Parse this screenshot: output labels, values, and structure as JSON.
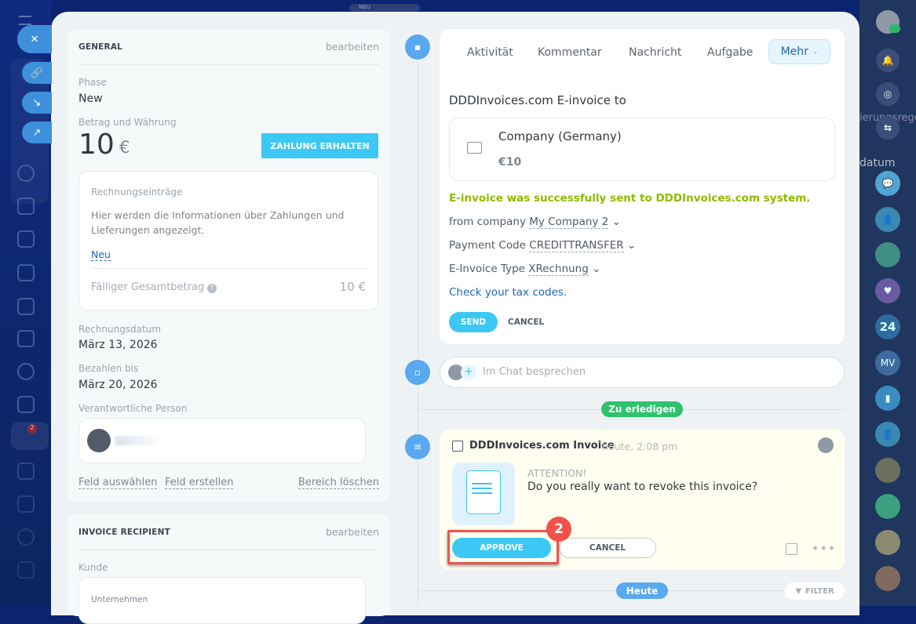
{
  "left_nav": {
    "badge": "2"
  },
  "top": {
    "new_label": "NEU",
    "badge": "2"
  },
  "right_nav": {
    "avatar_24": "24",
    "avatar_mv": "MV",
    "bg_text_1": "ierungsrege",
    "bg_text_2": "datum"
  },
  "general": {
    "title": "GENERAL",
    "edit": "bearbeiten",
    "phase_label": "Phase",
    "phase_value": "New",
    "amount_label": "Betrag und Währung",
    "amount": "10",
    "currency": "€",
    "pay_button": "ZAHLUNG ERHALTEN",
    "items_title": "Rechnungseinträge",
    "items_info": "Hier werden die Informationen über Zahlungen und Lieferungen angezeigt.",
    "items_new": "Neu",
    "total_label": "Fälliger Gesamtbetrag",
    "total_value": "10 €",
    "invoice_date_label": "Rechnungsdatum",
    "invoice_date": "März 13, 2026",
    "due_label": "Bezahlen bis",
    "due_date": "März 20, 2026",
    "responsible_label": "Verantwortliche Person",
    "select_field": "Feld auswählen",
    "create_field": "Feld erstellen",
    "delete_section": "Bereich löschen"
  },
  "recipient": {
    "title": "INVOICE RECIPIENT",
    "edit": "bearbeiten",
    "customer_label": "Kunde",
    "company_label": "Unternehmen"
  },
  "editor": {
    "tabs": [
      "Aktivität",
      "Kommentar",
      "Nachricht",
      "Aufgabe"
    ],
    "more": "Mehr",
    "heading": "DDDInvoices.com E-invoice to",
    "company": "Company (Germany)",
    "amount": "€10",
    "success": "E-invoice was successfully sent to DDDInvoices.com system.",
    "from_label": "from company",
    "from_value": "My Company 2",
    "payment_label": "Payment Code",
    "payment_value": "CREDITTRANSFER",
    "type_label": "E-Invoice Type",
    "type_value": "XRechnung",
    "tax_link": "Check your tax codes.",
    "send": "SEND",
    "cancel": "CANCEL"
  },
  "chat": {
    "placeholder": "Im Chat besprechen"
  },
  "todo_label": "Zu erledigen",
  "activity": {
    "title": "DDDInvoices.com Invoice",
    "time": "heute, 2:08 pm",
    "attention": "ATTENTION!",
    "question": "Do you really want to revoke this invoice?",
    "approve": "APPROVE",
    "cancel": "CANCEL",
    "step": "2"
  },
  "today_label": "Heute",
  "filter": "FILTER",
  "colors": {
    "accent": "#3bc8f5",
    "success": "#8dbb00",
    "link": "#2067b0",
    "highlight": "#f0524a"
  }
}
